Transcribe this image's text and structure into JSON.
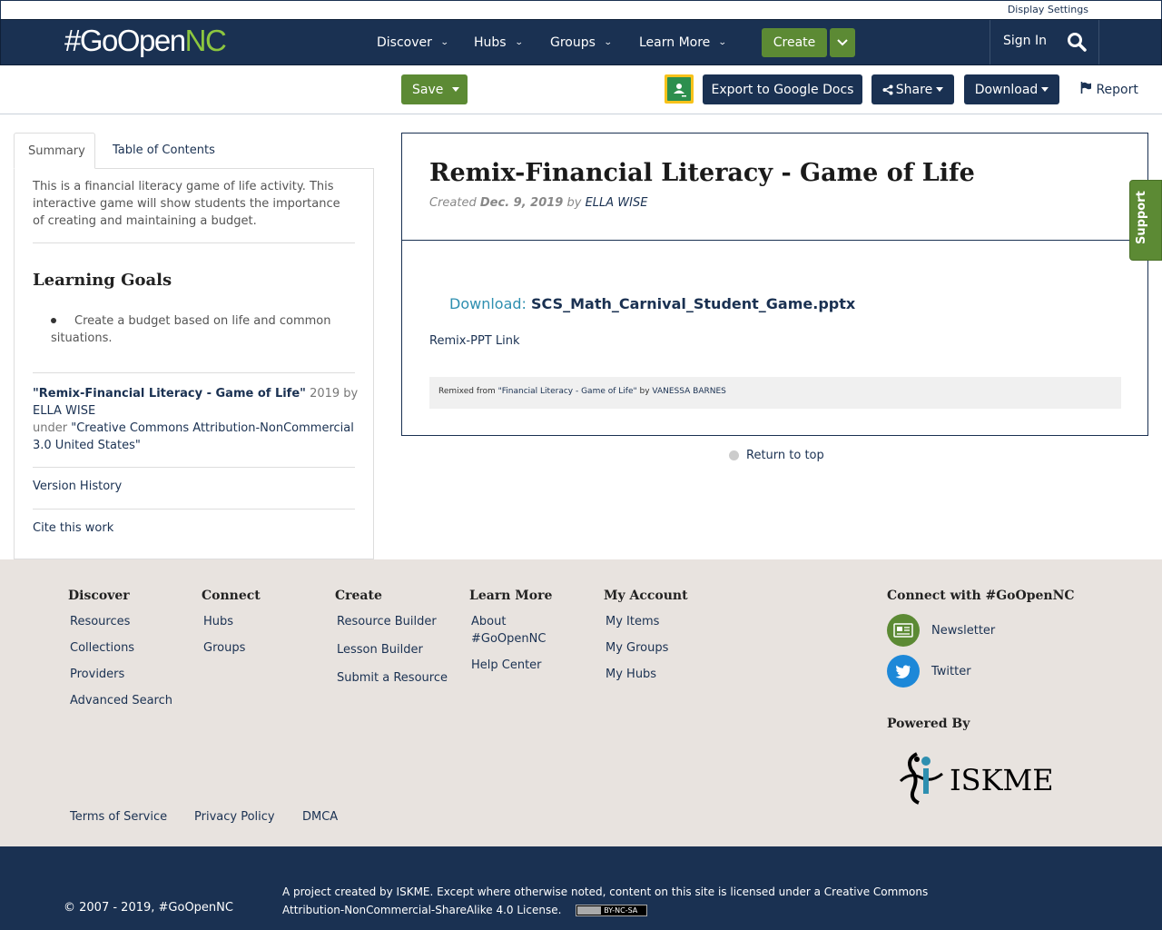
{
  "util": {
    "display_settings": "Display Settings"
  },
  "header": {
    "logo_main": "#GoOpen",
    "logo_accent": "NC",
    "nav": [
      {
        "label": "Discover"
      },
      {
        "label": "Hubs"
      },
      {
        "label": "Groups"
      },
      {
        "label": "Learn More"
      }
    ],
    "create_label": "Create",
    "sign_in": "Sign In"
  },
  "toolbar": {
    "save_label": "Save",
    "export_label": "Export to Google Docs",
    "share_label": "Share",
    "download_label": "Download",
    "report_label": "Report"
  },
  "sidebar": {
    "tabs": [
      "Summary",
      "Table of Contents"
    ],
    "summary": "This is a financial literacy game of life activity. This interactive game will show students the importance of creating and maintaining a budget.",
    "learning_goals_title": "Learning Goals",
    "learning_goals": [
      "Create a budget based on life and common situations."
    ],
    "attribution": {
      "title": "\"Remix-Financial Literacy - Game of Life\"",
      "year_by": " 2019 by ",
      "author": "ELLA WISE",
      "under": "under ",
      "license": "\"Creative Commons Attribution-NonCommercial 3.0 United States\""
    },
    "version_history": "Version History",
    "cite": "Cite this work"
  },
  "resource": {
    "title": "Remix-Financial Literacy - Game of Life",
    "created_label": "Created ",
    "created_date": "Dec. 9, 2019",
    "by_label": " by ",
    "author": "ELLA WISE",
    "download_label": "Download: ",
    "download_file": "SCS_Math_Carnival_Student_Game.pptx",
    "remix_link": "Remix-PPT Link",
    "remixed_from_label": "Remixed from ",
    "remixed_from_title": "\"Financial Literacy - Game of Life\"",
    "remixed_by_label": " by ",
    "remixed_author": "VANESSA BARNES",
    "return_to_top": "Return to top"
  },
  "support_label": "Support",
  "footer": {
    "columns": [
      {
        "title": "Discover",
        "links": [
          "Resources",
          "Collections",
          "Providers",
          "Advanced Search"
        ]
      },
      {
        "title": "Connect",
        "links": [
          "Hubs",
          "Groups"
        ]
      },
      {
        "title": "Create",
        "links": [
          "Resource Builder",
          "Lesson Builder",
          "Submit a Resource"
        ]
      },
      {
        "title": "Learn More",
        "links": [
          "About #GoOpenNC",
          "Help Center"
        ]
      },
      {
        "title": "My Account",
        "links": [
          "My Items",
          "My Groups",
          "My Hubs"
        ]
      }
    ],
    "connect_title": "Connect with #GoOpenNC",
    "newsletter": "Newsletter",
    "twitter": "Twitter",
    "powered_by": "Powered By",
    "iskme_logo_text": "ISKME",
    "legal": [
      "Terms of Service",
      "Privacy Policy",
      "DMCA"
    ],
    "copyright": "© 2007 - 2019, #GoOpenNC",
    "project_text": "A project created by ISKME. Except where otherwise noted, content on this site is licensed under a Creative Commons Attribution-NonCommercial-ShareAlike 4.0 License.",
    "cc_badge": "BY-NC-SA"
  },
  "colors": {
    "navy": "#1a3152",
    "green": "#5c8a34",
    "accent_green": "#8cc63f",
    "footer_bg": "#e8e3df"
  }
}
